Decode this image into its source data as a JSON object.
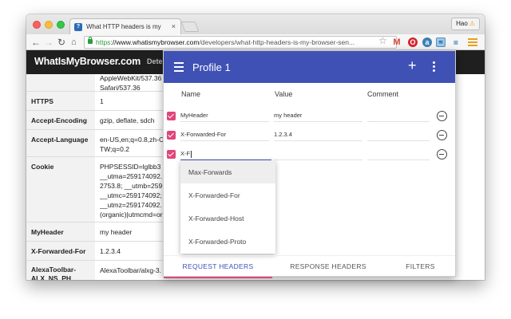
{
  "browser": {
    "tab_title": "What HTTP headers is my",
    "tab_close": "×",
    "user_name": "Hao",
    "url_https": "https",
    "url_host": "://www.whatismybrowser.com",
    "url_path": "/developers/what-http-headers-is-my-browser-sen..."
  },
  "site": {
    "logo": "WhatIsMyBrowser.com",
    "nav_partial": "Dete",
    "rows": [
      {
        "name": "",
        "value": "AppleWebKit/537.36\nSafari/537.36"
      },
      {
        "name": "HTTPS",
        "value": "1"
      },
      {
        "name": "Accept-Encoding",
        "value": "gzip, deflate, sdch"
      },
      {
        "name": "Accept-Language",
        "value": "en-US,en;q=0.8,zh-C\nTW;q=0.2"
      },
      {
        "name": "Cookie",
        "value": "PHPSESSID=lglbb3\n__utma=259174092.\n2753.8; __utmb=259\n__utmc=259174092;\n__utmz=259174092.\n(organic)|utmcmd=or"
      },
      {
        "name": "MyHeader",
        "value": "my header"
      },
      {
        "name": "X-Forwarded-For",
        "value": "1.2.3.4"
      },
      {
        "name": "AlexaToolbar-\nALX_NS_PH",
        "value": "AlexaToolbar/alxg-3."
      }
    ]
  },
  "panel": {
    "title": "Profile 1",
    "add_icon": "+",
    "columns": {
      "name": "Name",
      "value": "Value",
      "comment": "Comment"
    },
    "headers": [
      {
        "name": "MyHeader",
        "value": "my header",
        "comment": ""
      },
      {
        "name": "X-Forwarded-For",
        "value": "1.2.3.4",
        "comment": ""
      }
    ],
    "editing": {
      "name": "X-F",
      "value": "",
      "comment": ""
    },
    "autocomplete": [
      "Max-Forwards",
      "X-Forwarded-For",
      "X-Forwarded-Host",
      "X-Forwarded-Proto"
    ],
    "tabs": [
      "REQUEST HEADERS",
      "RESPONSE HEADERS",
      "FILTERS"
    ]
  },
  "colors": {
    "primary": "#3f51b5",
    "accent": "#e0457b"
  }
}
